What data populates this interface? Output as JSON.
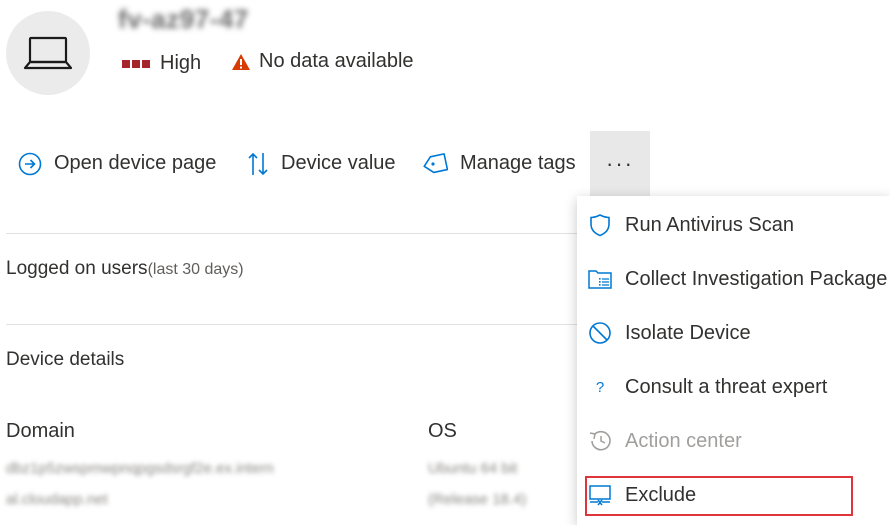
{
  "device": {
    "name": "fv-az97-47",
    "risk_level": "High",
    "exposure": "No data available"
  },
  "toolbar": {
    "open_device_page": "Open device page",
    "device_value": "Device value",
    "manage_tags": "Manage tags",
    "more": "···"
  },
  "sections": {
    "logged_on_users": "Logged on users",
    "logged_on_users_range": "(last 30 days)",
    "device_details": "Device details"
  },
  "details": {
    "domain_label": "Domain",
    "domain_value_line1": "dbz1p5zwspmwpnqpgsdsrgf2e.ex.intern",
    "domain_value_line2": "al.cloudapp.net",
    "os_label": "OS",
    "os_value_line1": "Ubuntu 64 bit",
    "os_value_line2": "(Release 18.4)"
  },
  "menu": {
    "items": [
      {
        "label": "Run Antivirus Scan",
        "icon": "shield-icon",
        "enabled": true
      },
      {
        "label": "Collect Investigation Package",
        "icon": "investigation-package-icon",
        "enabled": true
      },
      {
        "label": "Isolate Device",
        "icon": "isolate-icon",
        "enabled": true
      },
      {
        "label": "Consult a threat expert",
        "icon": "question-icon",
        "enabled": true
      },
      {
        "label": "Action center",
        "icon": "history-icon",
        "enabled": false
      },
      {
        "label": "Exclude",
        "icon": "exclude-device-icon",
        "enabled": true
      }
    ]
  },
  "colors": {
    "risk_high": "#a4262c",
    "warning": "#d83b01",
    "accent": "#0078d4",
    "highlight": "#e0343b"
  }
}
